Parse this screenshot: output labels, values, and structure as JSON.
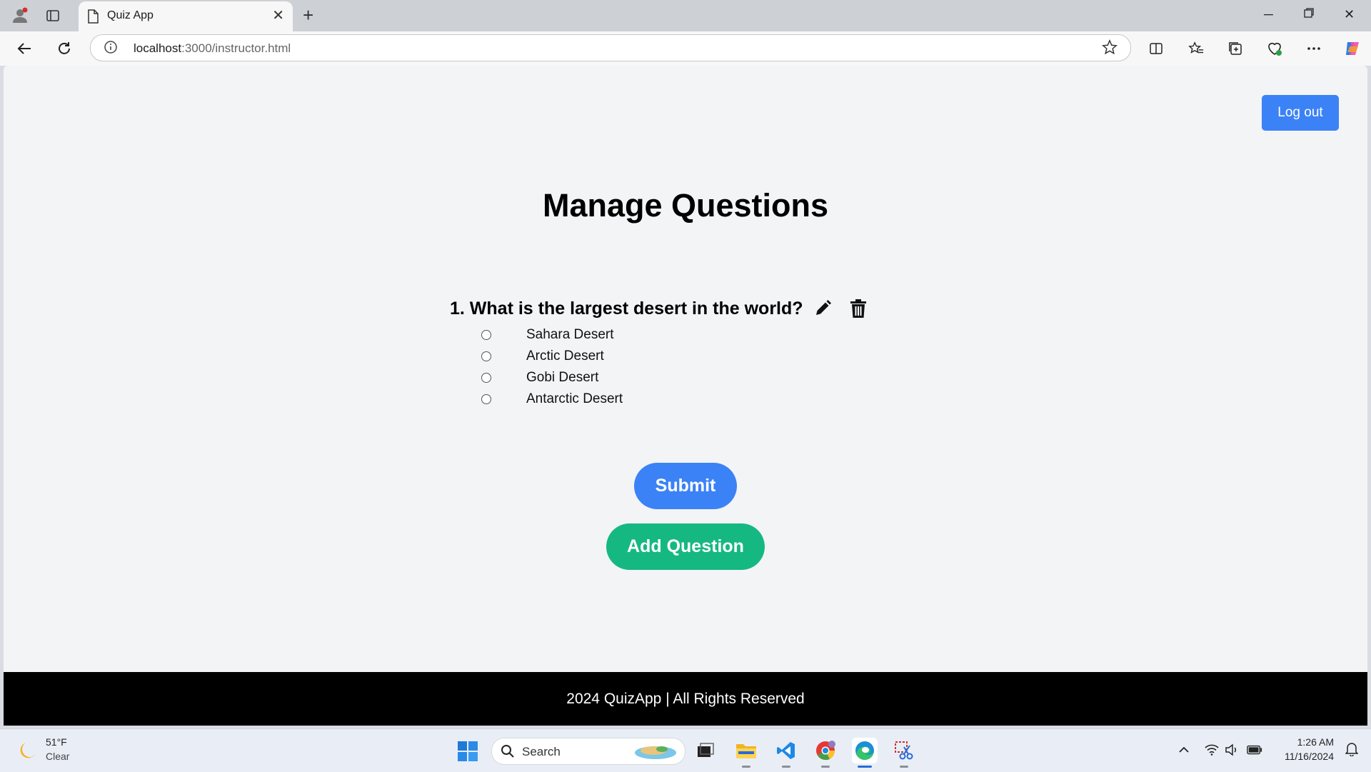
{
  "browser": {
    "tab_title": "Quiz App",
    "url_host": "localhost",
    "url_path": ":3000/instructor.html"
  },
  "page": {
    "logout_label": "Log out",
    "title": "Manage Questions",
    "question": {
      "text": "1. What is the largest desert in the world?",
      "options": [
        "Sahara Desert",
        "Arctic Desert",
        "Gobi Desert",
        "Antarctic Desert"
      ]
    },
    "submit_label": "Submit",
    "add_question_label": "Add Question",
    "footer_text": "2024 QuizApp | All Rights Reserved"
  },
  "taskbar": {
    "weather_temp": "51°F",
    "weather_cond": "Clear",
    "search_placeholder": "Search",
    "time": "1:26 AM",
    "date": "11/16/2024"
  },
  "colors": {
    "primary": "#3b82f6",
    "success": "#16b881",
    "footer": "#000000",
    "page_bg": "#f3f4f6"
  }
}
